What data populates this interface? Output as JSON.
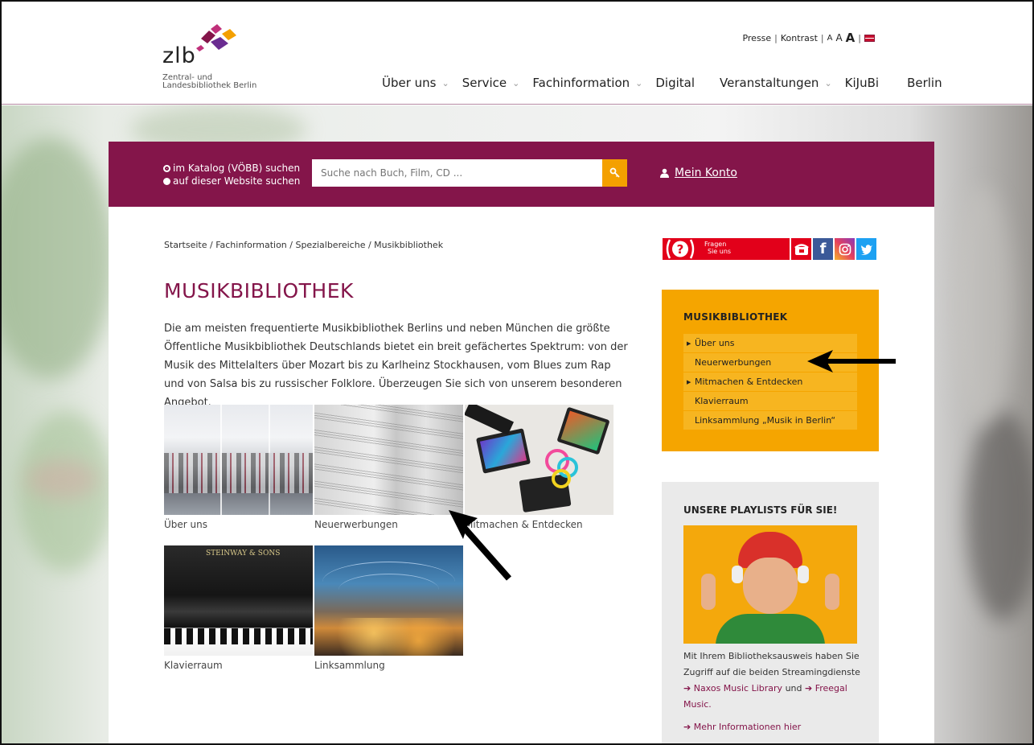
{
  "header": {
    "logo": {
      "text": "zlb",
      "subtitle_line1": "Zentral- und",
      "subtitle_line2": "Landesbibliothek Berlin"
    },
    "utility": {
      "presse": "Presse",
      "kontrast": "Kontrast",
      "font_small": "A",
      "font_medium": "A",
      "font_large": "A",
      "sep": "|"
    },
    "nav": [
      {
        "label": "Über uns",
        "dropdown": true
      },
      {
        "label": "Service",
        "dropdown": true
      },
      {
        "label": "Fachinformation",
        "dropdown": true
      },
      {
        "label": "Digital",
        "dropdown": false
      },
      {
        "label": "Veranstaltungen",
        "dropdown": true
      },
      {
        "label": "KiJuBi",
        "dropdown": false
      },
      {
        "label": "Berlin",
        "dropdown": false
      }
    ],
    "caret": "⌄"
  },
  "search": {
    "option_catalog": "im Katalog (VÖBB) suchen",
    "option_website": "auf dieser Website suchen",
    "placeholder": "Suche nach Buch, Film, CD ...",
    "account_label": "Mein Konto"
  },
  "content": {
    "breadcrumb": "Startseite / Fachinformation / Spezialbereiche / Musikbibliothek",
    "title": "MUSIKBIBLIOTHEK",
    "intro": "Die am meisten frequentierte Musikbibliothek Berlins und neben München die größte Öffentliche Musikbibliothek Deutschlands bietet ein breit gefächertes Spektrum: von der Musik des Mittelalters über Mozart bis zu Karlheinz Stockhausen, vom Blues zum Rap und von Salsa bis zu russischer Folklore. Überzeugen Sie sich von unserem besonderen Angebot.",
    "tiles": [
      {
        "caption": "Über uns"
      },
      {
        "caption": "Neuerwerbungen"
      },
      {
        "caption": "Mitmachen & Entdecken"
      },
      {
        "caption": "Klavierraum"
      },
      {
        "caption": "Linksammlung"
      }
    ],
    "steinway_text": "STEINWAY & SONS"
  },
  "sidebar": {
    "fragen_line1": "Fragen",
    "fragen_line2": "Sie uns",
    "menu_title": "MUSIKBIBLIOTHEK",
    "menu_items": [
      {
        "label": "Über uns",
        "expandable": true
      },
      {
        "label": "Neuerwerbungen",
        "expandable": false
      },
      {
        "label": "Mitmachen & Entdecken",
        "expandable": true
      },
      {
        "label": "Klavierraum",
        "expandable": false
      },
      {
        "label": "Linksammlung „Musik in Berlin“",
        "expandable": false
      }
    ],
    "playlist_title": "UNSERE PLAYLISTS FÜR SIE!",
    "playlist_text_1": "Mit Ihrem Bibliotheksausweis haben Sie Zugriff auf die beiden Streamingdienste ",
    "naxos_link": "➔ Naxos Music Library",
    "playlist_text_2": " und ",
    "freegal_link": "➔ Freegal Music.",
    "more_link": "➔ Mehr Informationen hier"
  },
  "colors": {
    "brand": "#84154a",
    "accent": "#f5a500",
    "search_button": "#f4a000"
  }
}
